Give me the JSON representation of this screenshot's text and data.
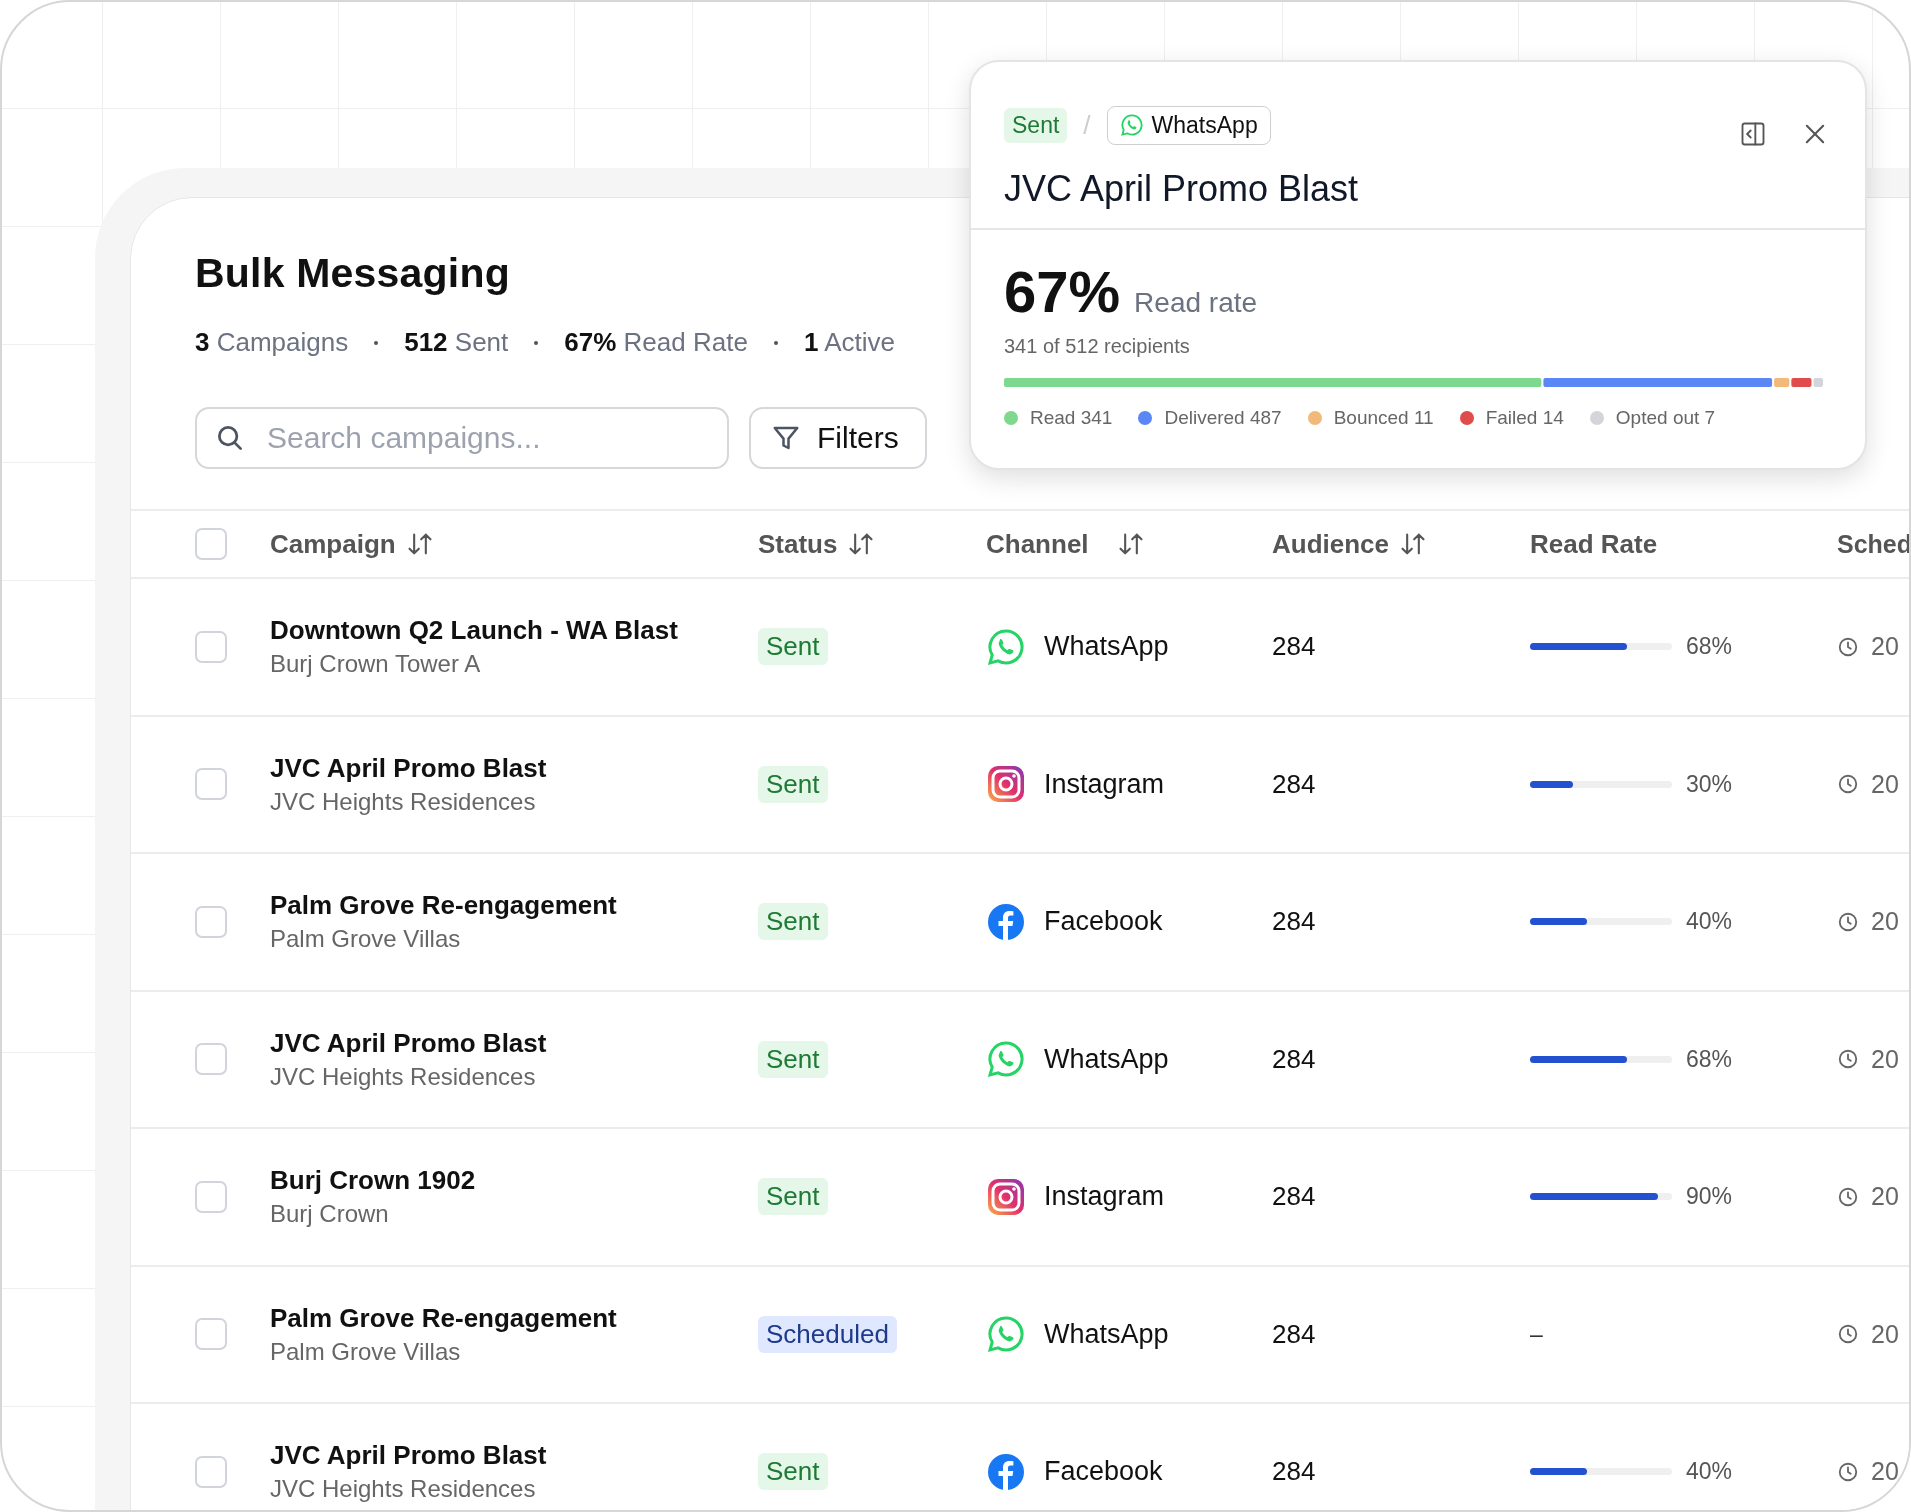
{
  "page": {
    "title": "Bulk Messaging",
    "stats": [
      {
        "value": "3",
        "label": "Campaigns"
      },
      {
        "value": "512",
        "label": "Sent"
      },
      {
        "value": "67%",
        "label": "Read Rate"
      },
      {
        "value": "1",
        "label": "Active"
      }
    ],
    "search": {
      "placeholder": "Search campaigns..."
    },
    "filters_button": "Filters"
  },
  "table": {
    "header_checkbox": {
      "checked": false
    },
    "columns": [
      {
        "label": "Campaign",
        "sortable": true
      },
      {
        "label": "Status",
        "sortable": true
      },
      {
        "label": "Channel",
        "sortable": true
      },
      {
        "label": "Audience",
        "sortable": true
      },
      {
        "label": "Read Rate",
        "sortable": false
      },
      {
        "label": "Sched"
      }
    ],
    "rows": [
      {
        "checked": false,
        "name": "Downtown Q2 Launch - WA Blast",
        "property": "Burj Crown Tower A",
        "status": {
          "label": "Sent",
          "kind": "sent"
        },
        "channel": {
          "label": "WhatsApp",
          "kind": "whatsapp"
        },
        "audience": "284",
        "read": {
          "level": 0.68,
          "reading": "68%"
        },
        "schedule": "20"
      },
      {
        "checked": false,
        "name": "JVC April Promo Blast",
        "property": "JVC Heights Residences",
        "status": {
          "label": "Sent",
          "kind": "sent"
        },
        "channel": {
          "label": "Instagram",
          "kind": "instagram"
        },
        "audience": "284",
        "read": {
          "level": 0.3,
          "reading": "30%"
        },
        "schedule": "20"
      },
      {
        "checked": false,
        "name": "Palm Grove Re-engagement",
        "property": "Palm Grove Villas",
        "status": {
          "label": "Sent",
          "kind": "sent"
        },
        "channel": {
          "label": "Facebook",
          "kind": "facebook"
        },
        "audience": "284",
        "read": {
          "level": 0.4,
          "reading": "40%"
        },
        "schedule": "20"
      },
      {
        "checked": false,
        "name": "JVC April Promo Blast",
        "property": "JVC Heights Residences",
        "status": {
          "label": "Sent",
          "kind": "sent"
        },
        "channel": {
          "label": "WhatsApp",
          "kind": "whatsapp"
        },
        "audience": "284",
        "read": {
          "level": 0.68,
          "reading": "68%"
        },
        "schedule": "20"
      },
      {
        "checked": false,
        "name": "Burj Crown 1902",
        "property": "Burj Crown",
        "status": {
          "label": "Sent",
          "kind": "sent"
        },
        "channel": {
          "label": "Instagram",
          "kind": "instagram"
        },
        "audience": "284",
        "read": {
          "level": 0.9,
          "reading": "90%"
        },
        "schedule": "20"
      },
      {
        "checked": false,
        "name": "Palm Grove Re-engagement",
        "property": "Palm Grove Villas",
        "status": {
          "label": "Scheduled",
          "kind": "scheduled"
        },
        "channel": {
          "label": "WhatsApp",
          "kind": "whatsapp"
        },
        "audience": "284",
        "read": {
          "reading": "–"
        },
        "schedule": "20"
      },
      {
        "checked": false,
        "name": "JVC April Promo Blast",
        "property": "JVC Heights Residences",
        "status": {
          "label": "Sent",
          "kind": "sent"
        },
        "channel": {
          "label": "Facebook",
          "kind": "facebook"
        },
        "audience": "284",
        "read": {
          "level": 0.4,
          "reading": "40%"
        },
        "schedule": "20"
      }
    ]
  },
  "popover": {
    "status": {
      "label": "Sent",
      "kind": "sent"
    },
    "separator": "/",
    "channel": {
      "label": "WhatsApp",
      "kind": "whatsapp"
    },
    "title": "JVC April Promo Blast",
    "rate": "67%",
    "rate_label": "Read rate",
    "recipients": "341 of 512 recipients",
    "legend": [
      {
        "label": "Read 341",
        "color": "#7ed88e"
      },
      {
        "label": "Delivered 487",
        "color": "#5b86f5"
      },
      {
        "label": "Bounced 11",
        "color": "#f2b97a"
      },
      {
        "label": "Failed 14",
        "color": "#e04b4b"
      },
      {
        "label": "Opted out 7",
        "color": "#d3d5da"
      }
    ]
  }
}
